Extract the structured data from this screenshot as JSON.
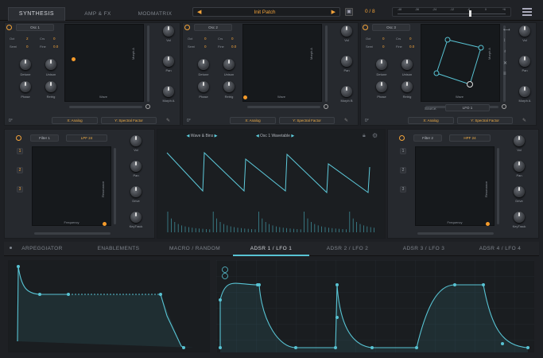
{
  "top_tabs": [
    "SYNTHESIS",
    "AMP & FX",
    "MODMATRIX"
  ],
  "patch": {
    "name": "Init Patch",
    "counter": "0 / 8"
  },
  "meter_scale": [
    "-48",
    "-36",
    "-24",
    "-12",
    "-6",
    "0",
    "+6"
  ],
  "oscillators": [
    {
      "title": "Osc 1",
      "oct_label": "Oct",
      "oct_value": "2",
      "crs_label": "Crs",
      "crs_value": "0",
      "semi_label": "Semi",
      "semi_value": "0",
      "fine_label": "Fine",
      "fine_value": "0.0",
      "k1": "Detune",
      "k2": "Unison",
      "k3": "Phase",
      "k4": "Retrig",
      "vol": "Vol",
      "pan": "Pan",
      "morph": "Morph A",
      "wave": "Wave",
      "morph_axis": "Morph A",
      "x_sel": "X: Analog",
      "y_sel": "Y: Spectral Factor",
      "foot_left": "0°"
    },
    {
      "title": "Osc 2",
      "oct_label": "Oct",
      "oct_value": "0",
      "crs_label": "Crs",
      "crs_value": "0",
      "semi_label": "Semi",
      "semi_value": "0",
      "fine_label": "Fine",
      "fine_value": "0.0",
      "k1": "Detune",
      "k2": "Unison",
      "k3": "Phase",
      "k4": "Retrig",
      "vol": "Vol",
      "pan": "Pan",
      "morph": "Morph B",
      "wave": "Wave",
      "morph_axis": "Morph A",
      "x_sel": "X: Analog",
      "y_sel": "Y: Spectral Factor",
      "foot_left": "0°"
    },
    {
      "title": "Osc 3",
      "oct_label": "Oct",
      "oct_value": "0",
      "crs_label": "Crs",
      "crs_value": "0",
      "semi_label": "Semi",
      "semi_value": "0",
      "fine_label": "Fine",
      "fine_value": "0.0",
      "k1": "Detune",
      "k2": "Unison",
      "k3": "Phase",
      "k4": "Retrig",
      "vol": "Vol",
      "pan": "Pan",
      "morph": "Morph A",
      "wave": "Wave",
      "morph_axis": "Morph A",
      "x_sel": "X: Analog",
      "y_sel": "Y: Spectral Factor",
      "foot_left": "0°",
      "source_label": "Source:",
      "source_value": "LFO 1"
    }
  ],
  "filters": [
    {
      "title": "Filter 1",
      "type": "LPF 24",
      "axis_x": "Frequency",
      "axis_y": "Resonance",
      "vol": "Vol",
      "pan": "Pan",
      "drive": "Drive",
      "keytrack": "KeyTrack",
      "nums": [
        "1",
        "2",
        "3"
      ]
    },
    {
      "title": "Filter 2",
      "type": "HPF 24",
      "axis_x": "Frequency",
      "axis_y": "Resonance",
      "vol": "Vol",
      "pan": "Pan",
      "drive": "Drive",
      "keytrack": "KeyTrack",
      "nums": [
        "1",
        "2",
        "3"
      ]
    }
  ],
  "wave_display": {
    "mode": "Wave & Bins",
    "table": "Osc 1 Wavetable"
  },
  "bottom_tabs": [
    "ARPEGGIATOR",
    "ENABLEMENTS",
    "MACRO / RANDOM",
    "ADSR 1 / LFO 1",
    "ADSR 2 / LFO 2",
    "ADSR 3 / LFO 3",
    "ADSR 4 / LFO 4"
  ],
  "active_bottom_tab": 3
}
